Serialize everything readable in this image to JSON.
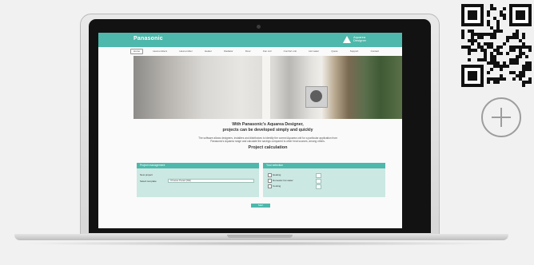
{
  "website": {
    "logo": "Panasonic",
    "brand_line1": "Aquarea",
    "brand_line2": "Designer",
    "nav": [
      "Home",
      "Heat emitters",
      "Heat emitter",
      "Heater",
      "Radiator",
      "Floor",
      "Fan coil",
      "Comfort unit",
      "Hot water",
      "Quote",
      "Support",
      "Contact"
    ],
    "heading_line1": "With Panasonic's Aquarea Designer,",
    "heading_line2": "projects can be developed simply and quickly",
    "body_line1": "The software allows designers, installers and distributors to identify the correct Aquarea unit for a particular application from",
    "body_line2": "Panasonic's Aquarea range and calculate the savings compared to other heat sources, among others.",
    "section_title": "Project calculation",
    "left_panel": {
      "title": "Project management",
      "field1_label": "New project",
      "field2_label": "Select template",
      "select_value": "Choose Panel (DE)"
    },
    "right_panel": {
      "title": "Your selection",
      "options": [
        "Heating",
        "Domestic hot water",
        "Cooling"
      ]
    },
    "button_label": "Start"
  },
  "colors": {
    "accent": "#4db8ab",
    "panel": "#cbe8e2",
    "background": "#f1f1f1"
  },
  "icons": {
    "qr": "qr-code-icon",
    "plus": "plus-icon"
  }
}
